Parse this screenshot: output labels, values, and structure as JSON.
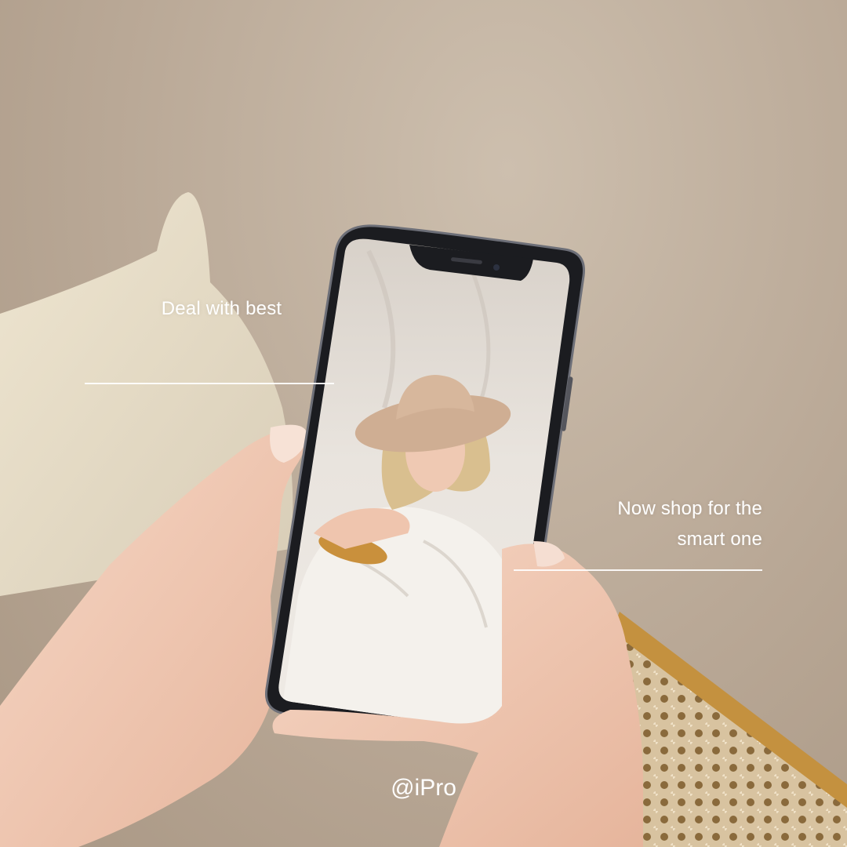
{
  "captions": {
    "top_left": "Deal with best",
    "right_line1": "Now shop for the",
    "right_line2": "smart one"
  },
  "handle": "@iPro",
  "colors": {
    "background": "#b9a896",
    "pillow": "#e3d9c3",
    "phone_frame": "#1b1c20",
    "screen_backdrop": "#e8e3dc",
    "hat": "#cfae93",
    "skin": "#f0c9b2",
    "chair_rattan": "#c99a4f",
    "text": "#ffffff"
  }
}
